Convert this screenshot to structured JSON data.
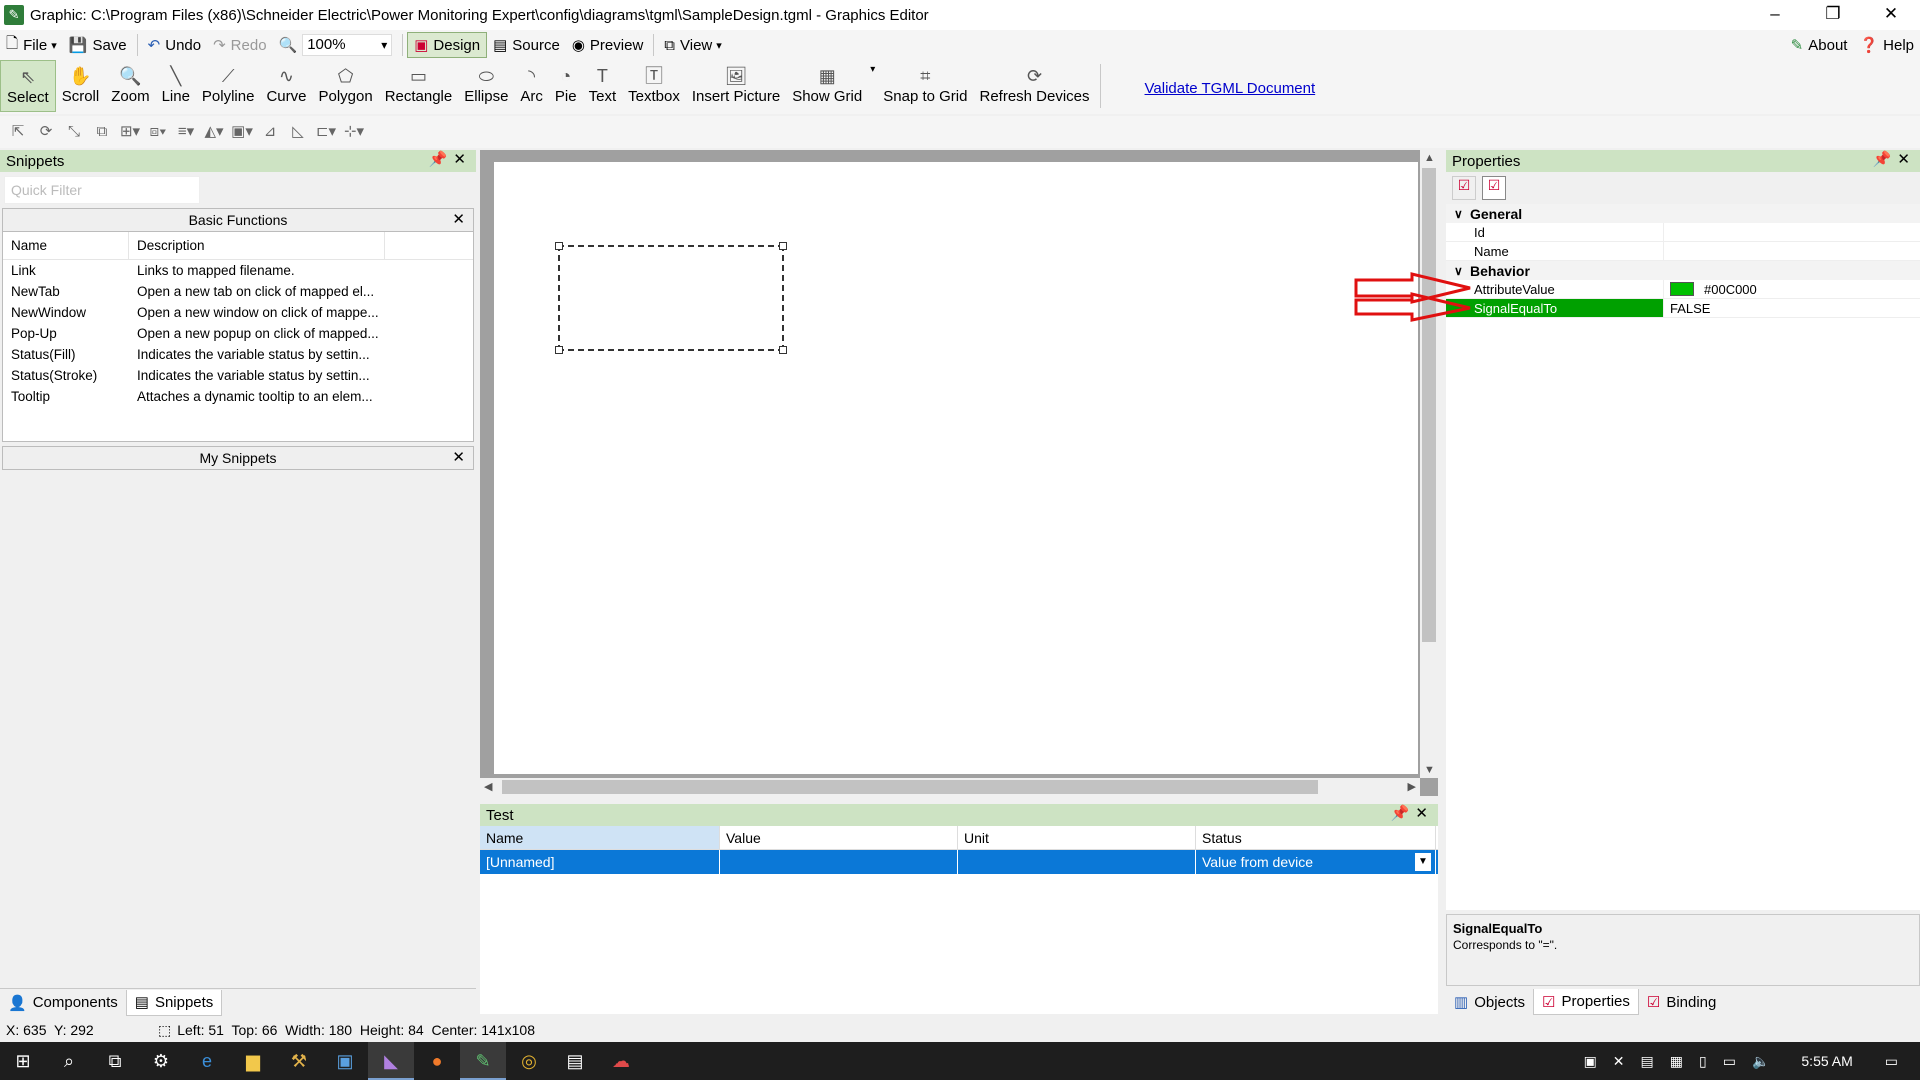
{
  "window": {
    "title": "Graphic: C:\\Program Files (x86)\\Schneider Electric\\Power Monitoring Expert\\config\\diagrams\\tgml\\SampleDesign.tgml - Graphics Editor"
  },
  "menubar": {
    "file": "File",
    "save": "Save",
    "undo": "Undo",
    "redo": "Redo",
    "zoom": "100%",
    "design": "Design",
    "source": "Source",
    "preview": "Preview",
    "view": "View",
    "about": "About",
    "help": "Help"
  },
  "tools": [
    {
      "label": "Select",
      "icon": "⇖"
    },
    {
      "label": "Scroll",
      "icon": "✋"
    },
    {
      "label": "Zoom",
      "icon": "🔍"
    },
    {
      "label": "Line",
      "icon": "╲"
    },
    {
      "label": "Polyline",
      "icon": "⟋"
    },
    {
      "label": "Curve",
      "icon": "∿"
    },
    {
      "label": "Polygon",
      "icon": "⬠"
    },
    {
      "label": "Rectangle",
      "icon": "▭"
    },
    {
      "label": "Ellipse",
      "icon": "⬭"
    },
    {
      "label": "Arc",
      "icon": "◝"
    },
    {
      "label": "Pie",
      "icon": "◔"
    },
    {
      "label": "Text",
      "icon": "T"
    },
    {
      "label": "Textbox",
      "icon": "🅃"
    },
    {
      "label": "Insert Picture",
      "icon": "🖼"
    },
    {
      "label": "Show Grid",
      "icon": "▦"
    },
    {
      "label": "Snap to Grid",
      "icon": "⌗"
    },
    {
      "label": "Refresh Devices",
      "icon": "⟳"
    }
  ],
  "validate_link": "Validate TGML Document",
  "snippets": {
    "title": "Snippets",
    "filter_placeholder": "Quick Filter",
    "basic_group": "Basic Functions",
    "col_name": "Name",
    "col_desc": "Description",
    "items": [
      {
        "name": "Link",
        "desc": "Links to mapped filename."
      },
      {
        "name": "NewTab",
        "desc": "Open a new tab on click of mapped el..."
      },
      {
        "name": "NewWindow",
        "desc": "Open a new window on click of mappe..."
      },
      {
        "name": "Pop-Up",
        "desc": "Open a new popup on click of mapped..."
      },
      {
        "name": "Status(Fill)",
        "desc": "Indicates the variable status by settin..."
      },
      {
        "name": "Status(Stroke)",
        "desc": "Indicates the variable status by settin..."
      },
      {
        "name": "Tooltip",
        "desc": "Attaches a dynamic tooltip to an elem..."
      }
    ],
    "my_group": "My Snippets"
  },
  "left_tabs": {
    "components": "Components",
    "snippets": "Snippets"
  },
  "test": {
    "title": "Test",
    "cols": [
      "Name",
      "Value",
      "Unit",
      "Status"
    ],
    "row": {
      "name": "[Unnamed]",
      "value": "",
      "unit": "",
      "status": "Value from device"
    }
  },
  "properties": {
    "title": "Properties",
    "general": "General",
    "id": "Id",
    "name": "Name",
    "behavior": "Behavior",
    "attr_name": "AttributeValue",
    "attr_value": "#00C000",
    "attr_color": "#00c000",
    "signal_name": "SignalEqualTo",
    "signal_value": "FALSE",
    "desc_title": "SignalEqualTo",
    "desc_text": "Corresponds to \"=\"."
  },
  "right_tabs": {
    "objects": "Objects",
    "properties": "Properties",
    "binding": "Binding"
  },
  "status": {
    "coords": "X: 635  Y: 292",
    "geometry": "Left: 51  Top: 66  Width: 180  Height: 84  Center: 141x108"
  },
  "taskbar": {
    "time": "5:55 AM"
  }
}
